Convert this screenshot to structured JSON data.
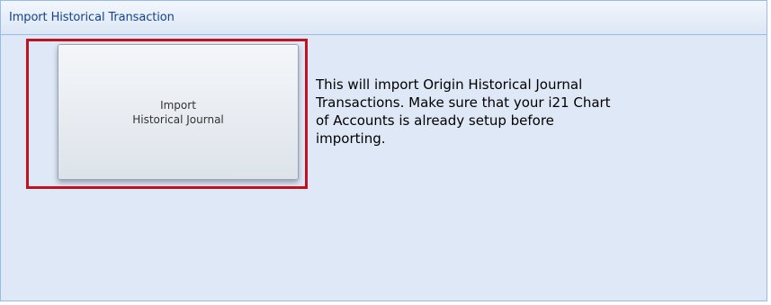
{
  "panel": {
    "title": "Import Historical Transaction"
  },
  "import_button": {
    "line1": "Import",
    "line2": "Historical Journal"
  },
  "description": {
    "lines": [
      "This will import Origin Historical Journal",
      "Transactions. Make sure that your i21 Chart",
      "of Accounts is already setup before",
      "importing."
    ]
  },
  "colors": {
    "panel_border": "#99bbe8",
    "panel_background": "#dfe8f6",
    "header_text": "#15428b",
    "highlight": "#c1121f"
  }
}
